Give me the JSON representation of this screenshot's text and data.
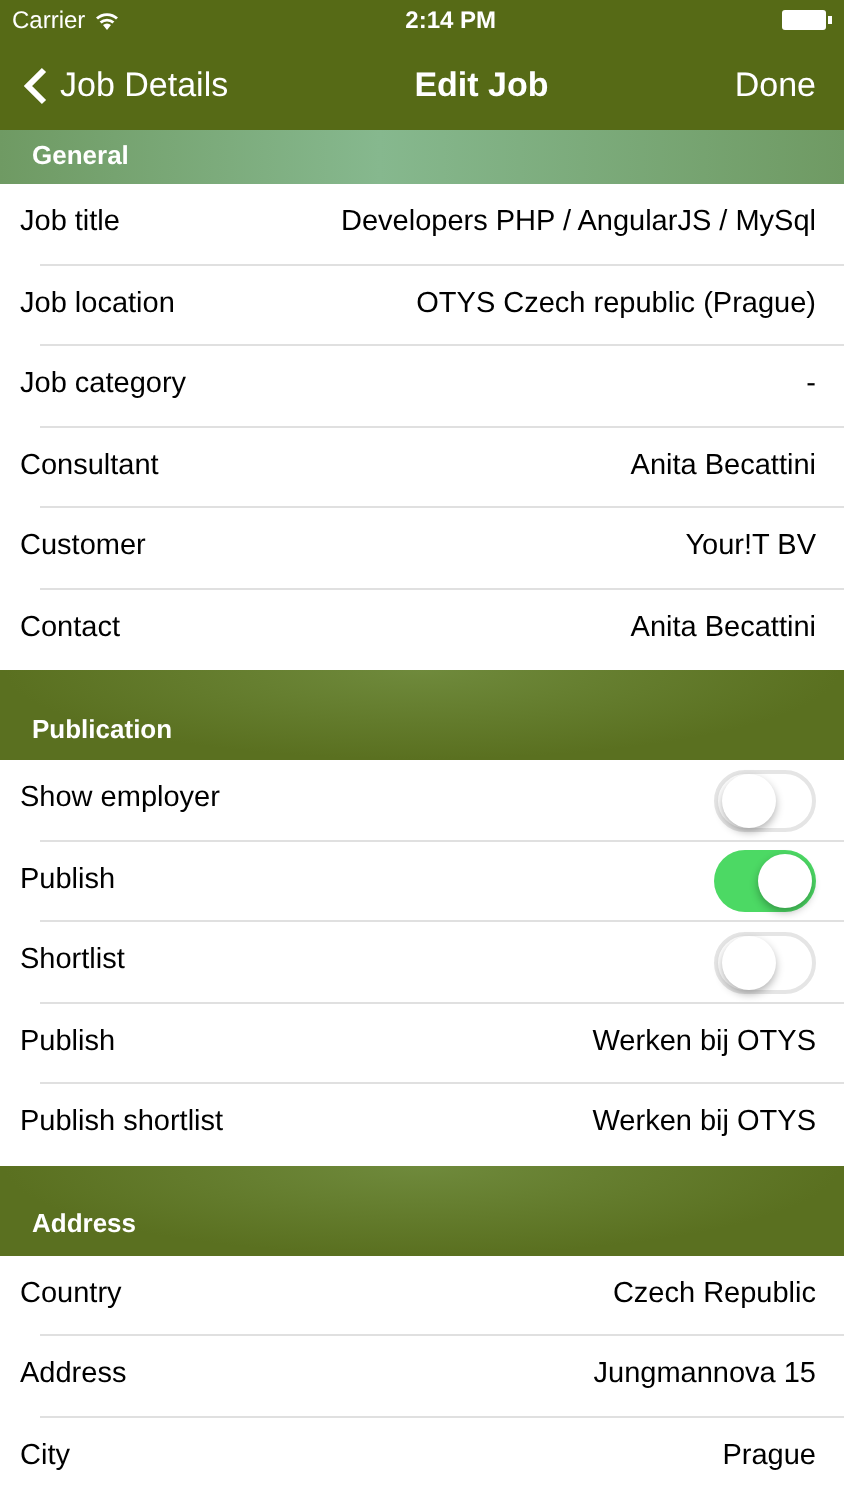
{
  "status_bar": {
    "carrier": "Carrier",
    "time": "2:14 PM"
  },
  "nav": {
    "back": "Job Details",
    "title": "Edit Job",
    "action": "Done"
  },
  "sections": [
    {
      "title": "General",
      "rows": [
        {
          "kind": "value",
          "label": "Job title",
          "value": "Developers PHP / AngularJS / MySql"
        },
        {
          "kind": "value",
          "label": "Job location",
          "value": "OTYS Czech republic (Prague)"
        },
        {
          "kind": "value",
          "label": "Job category",
          "value": "-"
        },
        {
          "kind": "value",
          "label": "Consultant",
          "value": "Anita Becattini"
        },
        {
          "kind": "value",
          "label": "Customer",
          "value": "Your!T BV"
        },
        {
          "kind": "value",
          "label": "Contact",
          "value": "Anita Becattini"
        }
      ]
    },
    {
      "title": "Publication",
      "rows": [
        {
          "kind": "toggle",
          "label": "Show employer",
          "on": false
        },
        {
          "kind": "toggle",
          "label": "Publish",
          "on": true
        },
        {
          "kind": "toggle",
          "label": "Shortlist",
          "on": false
        },
        {
          "kind": "value",
          "label": "Publish",
          "value": "Werken bij OTYS"
        },
        {
          "kind": "value",
          "label": "Publish shortlist",
          "value": "Werken bij OTYS"
        }
      ]
    },
    {
      "title": "Address",
      "rows": [
        {
          "kind": "value",
          "label": "Country",
          "value": "Czech Republic"
        },
        {
          "kind": "value",
          "label": "Address",
          "value": "Jungmannova 15"
        },
        {
          "kind": "value",
          "label": "City",
          "value": "Prague"
        }
      ]
    }
  ]
}
